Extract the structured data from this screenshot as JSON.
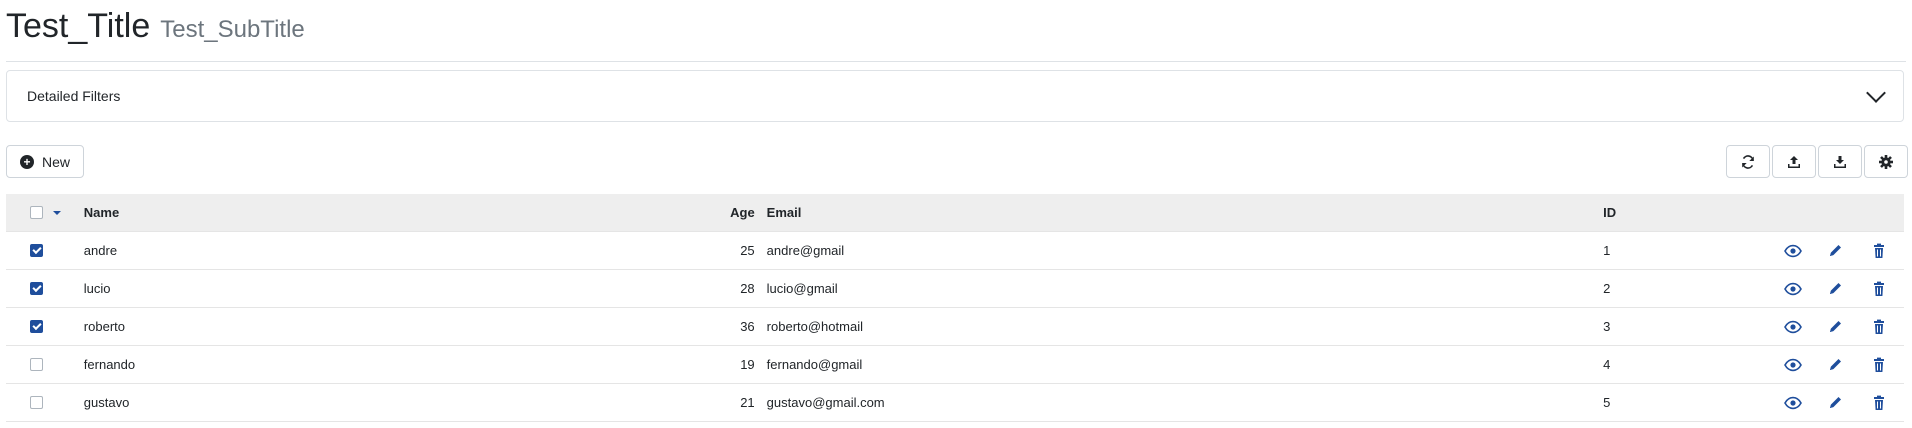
{
  "header": {
    "title": "Test_Title",
    "subtitle": "Test_SubTitle"
  },
  "filters": {
    "label": "Detailed Filters",
    "icon": "chevron-down-icon"
  },
  "toolbar": {
    "new_label": "New",
    "buttons": [
      "refresh-icon",
      "upload-icon",
      "download-icon",
      "gear-icon"
    ]
  },
  "table": {
    "columns": [
      "Name",
      "Age",
      "Email",
      "ID"
    ],
    "rows": [
      {
        "checked": true,
        "name": "andre",
        "age": "25",
        "email": "andre@gmail",
        "id": "1"
      },
      {
        "checked": true,
        "name": "lucio",
        "age": "28",
        "email": "lucio@gmail",
        "id": "2"
      },
      {
        "checked": true,
        "name": "roberto",
        "age": "36",
        "email": "roberto@hotmail",
        "id": "3"
      },
      {
        "checked": false,
        "name": "fernando",
        "age": "19",
        "email": "fernando@gmail",
        "id": "4"
      },
      {
        "checked": false,
        "name": "gustavo",
        "age": "21",
        "email": "gustavo@gmail.com",
        "id": "5"
      }
    ],
    "row_actions": [
      "eye-icon",
      "pencil-icon",
      "trash-icon"
    ]
  },
  "colors": {
    "accent": "#1f4e9c",
    "header_bg": "#eeeeee",
    "border": "#dee2e6"
  }
}
